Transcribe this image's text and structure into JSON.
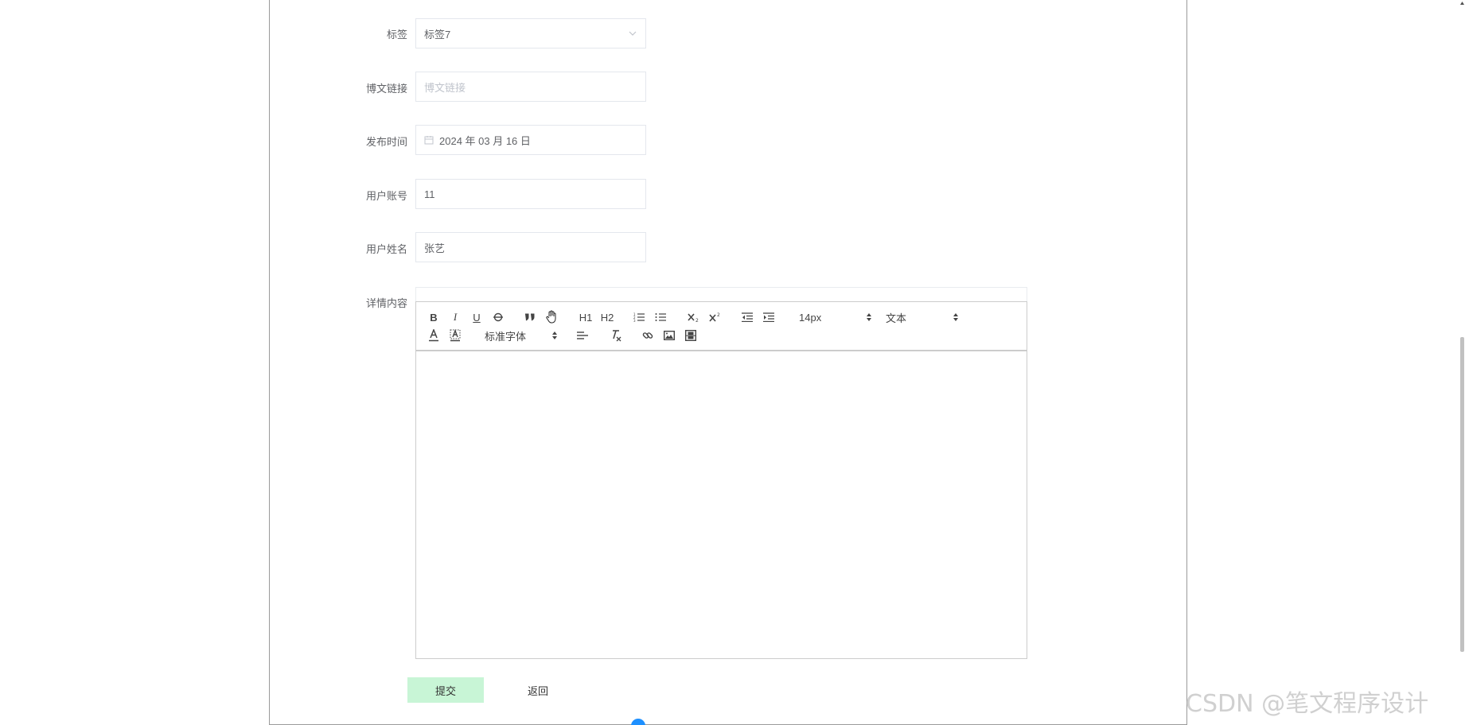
{
  "form": {
    "tag": {
      "label": "标签",
      "value": "标签7"
    },
    "blog_link": {
      "label": "博文链接",
      "placeholder": "博文链接"
    },
    "publish_time": {
      "label": "发布时间",
      "value": "2024 年 03 月 16 日"
    },
    "user_account": {
      "label": "用户账号",
      "value": "11"
    },
    "user_name": {
      "label": "用户姓名",
      "value": "张艺"
    },
    "detail": {
      "label": "详情内容"
    }
  },
  "editor": {
    "toolbar": {
      "bold": "B",
      "italic": "I",
      "underline": "U",
      "h1": "H1",
      "h2": "H2",
      "font_size": "14px",
      "header_select": "文本",
      "font_family": "标准字体"
    },
    "icons": [
      "bold-icon",
      "italic-icon",
      "underline-icon",
      "strike-icon",
      "blockquote-icon",
      "code-block-icon",
      "h1-icon",
      "h2-icon",
      "ordered-list-icon",
      "bullet-list-icon",
      "subscript-icon",
      "superscript-icon",
      "outdent-icon",
      "indent-icon",
      "font-color-icon",
      "background-color-icon",
      "align-icon",
      "clean-icon",
      "link-icon",
      "image-icon",
      "video-icon"
    ]
  },
  "buttons": {
    "submit": "提交",
    "back": "返回"
  },
  "watermark": "CSDN @笔文程序设计",
  "colors": {
    "submit_bg": "#c8f5d6",
    "border": "#e4e7ed",
    "label": "#606266"
  }
}
